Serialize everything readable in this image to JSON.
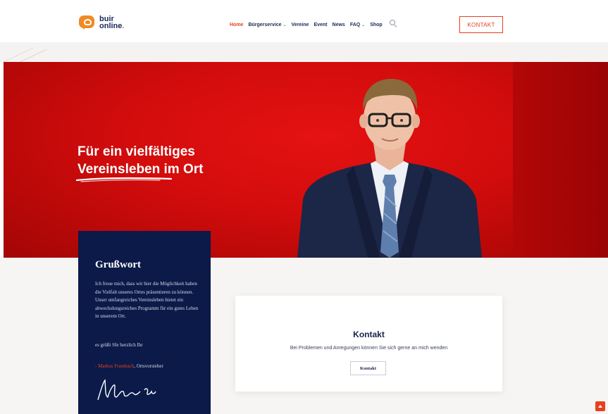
{
  "header": {
    "logo": {
      "line1": "buir",
      "line2": "online",
      "line2_dot": "."
    },
    "nav": [
      {
        "label": "Home",
        "active": true,
        "dropdown": false
      },
      {
        "label": "Bürgerservice",
        "active": false,
        "dropdown": true
      },
      {
        "label": "Vereine",
        "active": false,
        "dropdown": false
      },
      {
        "label": "Event",
        "active": false,
        "dropdown": false
      },
      {
        "label": "News",
        "active": false,
        "dropdown": false
      },
      {
        "label": "FAQ",
        "active": false,
        "dropdown": true
      },
      {
        "label": "Shop",
        "active": false,
        "dropdown": false
      }
    ],
    "search_icon": "search-icon",
    "cta_label": "KONTAKT"
  },
  "hero": {
    "title_line1": "Für ein vielfältiges",
    "title_highlight": "Vereinsleben",
    "title_line2_rest": " im Ort"
  },
  "grusswort": {
    "title": "Grußwort",
    "body": "Ich freue mich, dass wir hier die Möglichkeit haben die Vielfalt unseres Ortes präsentieren zu können. Unser umfangreiches Vereinsleben bietet ein abwechslungsreiches Programm für ein gutes Leben in unserem Ort.",
    "greeting": "es grüßt SIe herzlich Ihr",
    "author_name": "- Markus Frambach",
    "author_role": ", Ortsvorsteher"
  },
  "contact": {
    "title": "Kontakt",
    "subtitle": "Bei Problemen und Anregungen können Sie sich gerne an mich wenden",
    "button_label": "Kontakt"
  },
  "colors": {
    "accent": "#e8401c",
    "navy": "#0b1a48",
    "hero_red": "#d20c0c"
  }
}
